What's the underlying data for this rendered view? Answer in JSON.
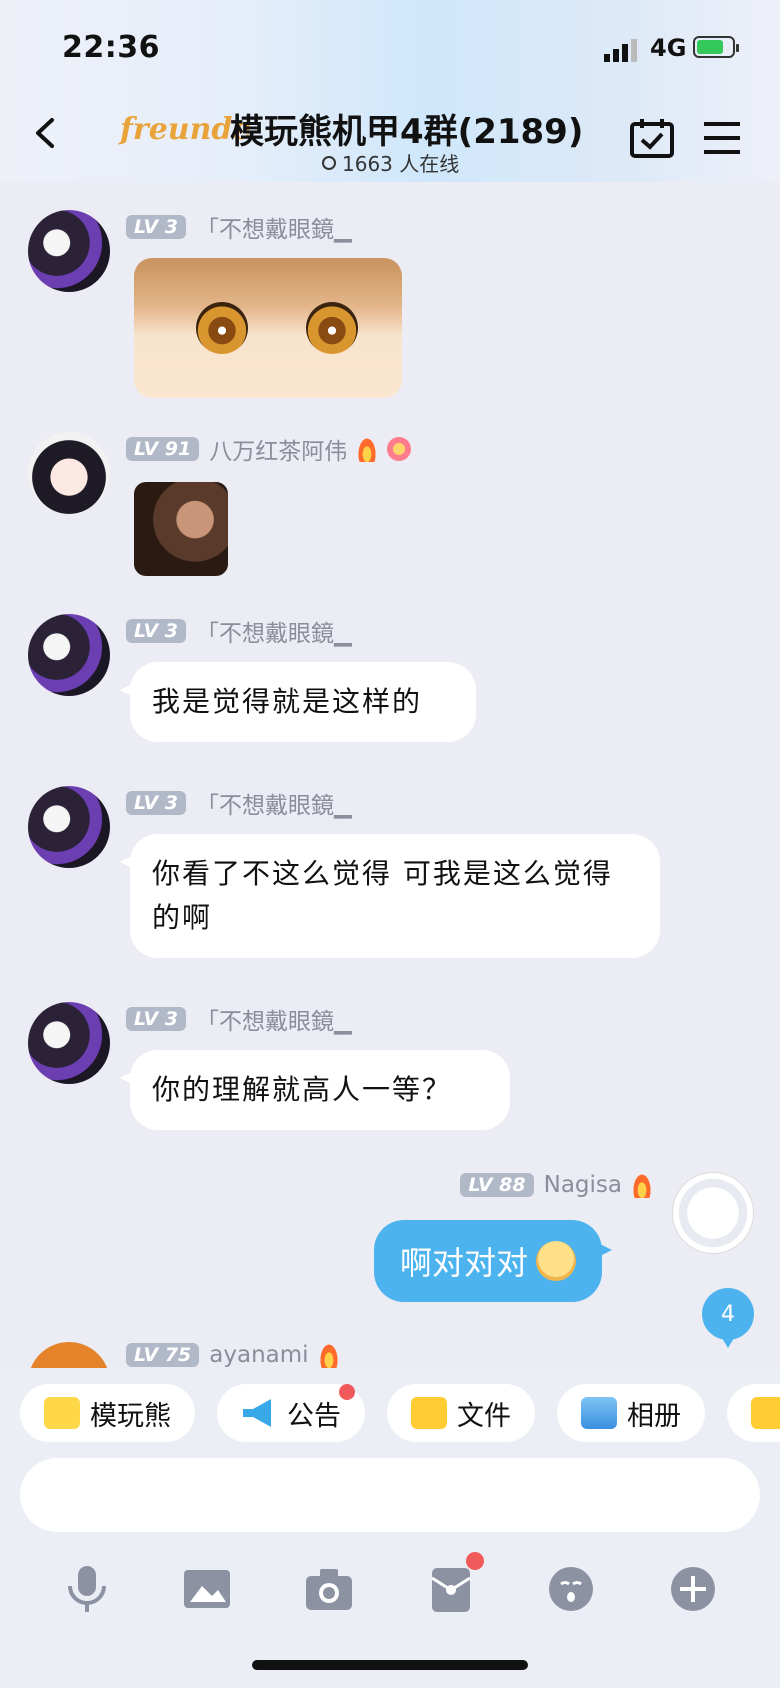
{
  "status": {
    "time": "22:36",
    "network": "4G"
  },
  "header": {
    "brand": "freunde",
    "title": "模玩熊机甲4群(2189)",
    "online": "1663 人在线"
  },
  "messages": [
    {
      "level": "LV 3",
      "name": "「不想戴眼鏡▁",
      "type": "sticker"
    },
    {
      "level": "LV 91",
      "name": "八万红茶阿伟",
      "type": "image"
    },
    {
      "level": "LV 3",
      "name": "「不想戴眼鏡▁",
      "text": "我是觉得就是这样的"
    },
    {
      "level": "LV 3",
      "name": "「不想戴眼鏡▁",
      "text": "你看了不这么觉得 可我是这么觉得的啊"
    },
    {
      "level": "LV 3",
      "name": "「不想戴眼鏡▁",
      "text": "你的理解就高人一等？"
    },
    {
      "level": "LV 88",
      "name": "Nagisa",
      "text": "啊对对对",
      "mine": true
    },
    {
      "level": "LV 75",
      "name": "ayanami"
    }
  ],
  "unread_count": "4",
  "shortcuts": [
    {
      "label": "模玩熊",
      "icon": "panda-icon"
    },
    {
      "label": "公告",
      "icon": "megaphone-icon"
    },
    {
      "label": "文件",
      "icon": "folder-icon"
    },
    {
      "label": "相册",
      "icon": "album-icon"
    }
  ],
  "toolbar": [
    "microphone-icon",
    "image-icon",
    "camera-icon",
    "red-packet-icon",
    "emoji-icon",
    "plus-icon"
  ],
  "colors": {
    "accent": "#4db3ef",
    "badge": "#f05a5a",
    "level_badge": "#b1b8c7"
  }
}
